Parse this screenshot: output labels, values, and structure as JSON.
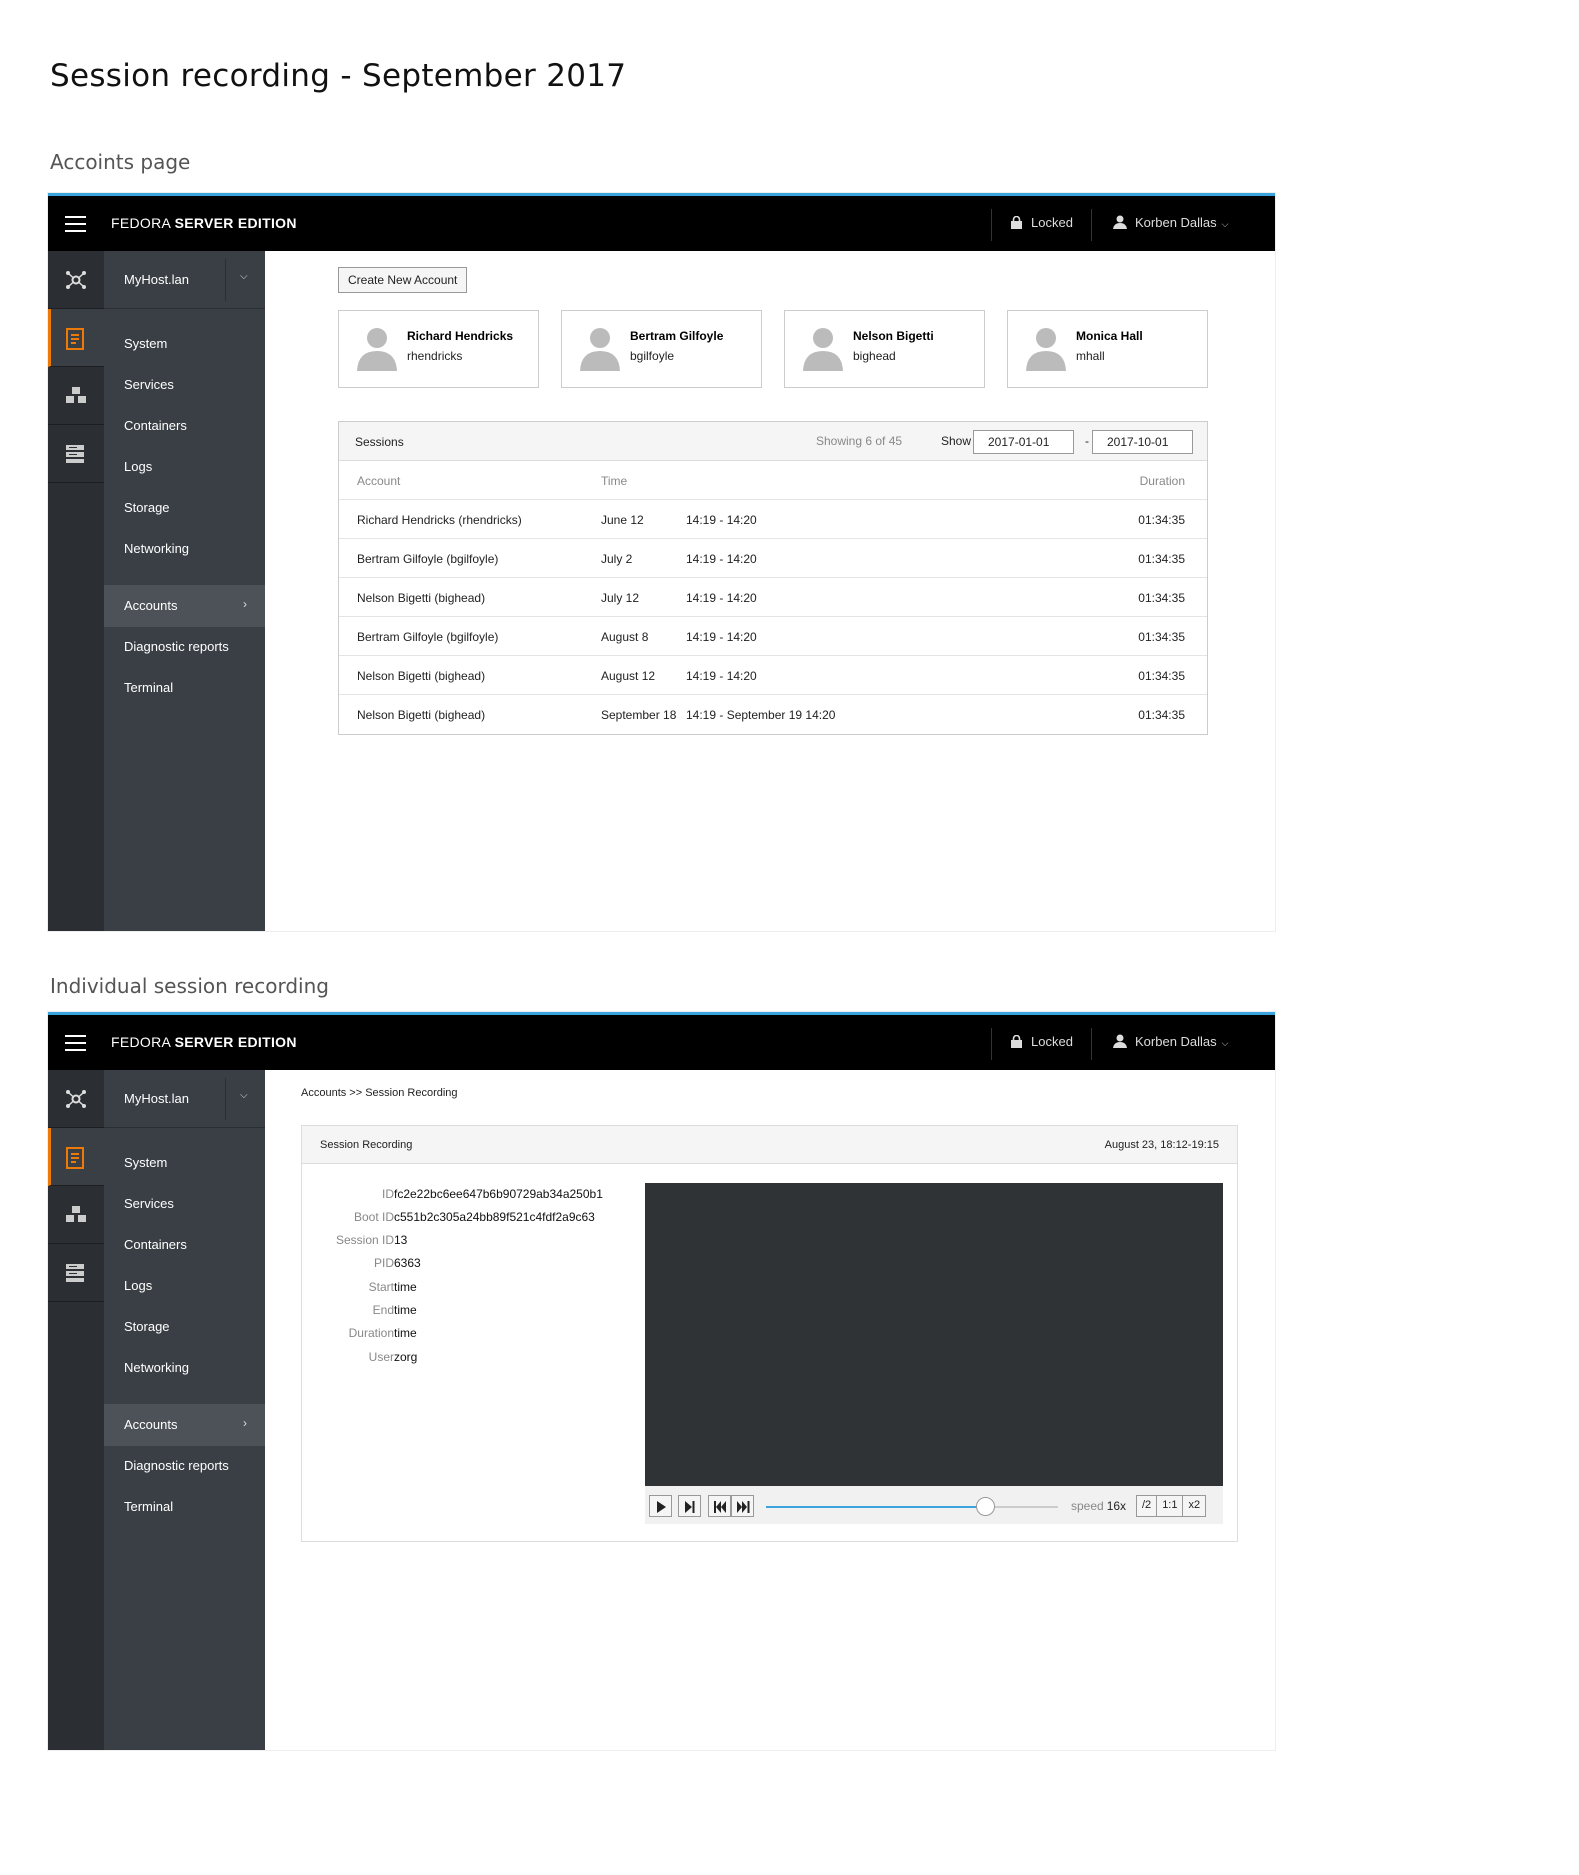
{
  "page_title": "Session recording - September 2017",
  "section1_title": "Accoints page",
  "section2_title": "Individual session recording",
  "topbar": {
    "brand_light": "FEDORA ",
    "brand_bold": "SERVER EDITION",
    "locked": "Locked",
    "user": "Korben Dallas"
  },
  "nav": {
    "host": "MyHost.lan",
    "items": [
      "System",
      "Services",
      "Containers",
      "Logs",
      "Storage",
      "Networking",
      "Accounts",
      "Diagnostic reports",
      "Terminal"
    ],
    "active": "Accounts"
  },
  "accounts": {
    "create_button": "Create New Account",
    "cards": [
      {
        "name": "Richard Hendricks",
        "user": "rhendricks"
      },
      {
        "name": "Bertram Gilfoyle",
        "user": "bgilfoyle"
      },
      {
        "name": "Nelson Bigetti",
        "user": "bighead"
      },
      {
        "name": "Monica Hall",
        "user": "mhall"
      }
    ]
  },
  "sessions": {
    "title": "Sessions",
    "showing": "Showing 6 of 45",
    "show_label": "Show",
    "date_from": "2017-01-01",
    "date_sep": "-",
    "date_to": "2017-10-01",
    "headers": {
      "account": "Account",
      "time": "Time",
      "duration": "Duration"
    },
    "rows": [
      {
        "account": "Richard Hendricks (rhendricks)",
        "date": "June 12",
        "range": "14:19 - 14:20",
        "duration": "01:34:35"
      },
      {
        "account": "Bertram Gilfoyle (bgilfoyle)",
        "date": "July 2",
        "range": "14:19 - 14:20",
        "duration": "01:34:35"
      },
      {
        "account": "Nelson Bigetti (bighead)",
        "date": "July 12",
        "range": "14:19 - 14:20",
        "duration": "01:34:35"
      },
      {
        "account": "Bertram Gilfoyle (bgilfoyle)",
        "date": "August 8",
        "range": "14:19 - 14:20",
        "duration": "01:34:35"
      },
      {
        "account": "Nelson Bigetti (bighead)",
        "date": "August 12",
        "range": "14:19 - 14:20",
        "duration": "01:34:35"
      },
      {
        "account": "Nelson Bigetti (bighead)",
        "date": "September 18",
        "range": "14:19 -  September 19 14:20",
        "duration": "01:34:35"
      }
    ]
  },
  "recording": {
    "breadcrumb": "Accounts >> Session Recording",
    "title": "Session Recording",
    "when": "August 23, 18:12-19:15",
    "fields": [
      {
        "k": "ID",
        "v": "fc2e22bc6ee647b6b90729ab34a250b1"
      },
      {
        "k": "Boot ID",
        "v": "c551b2c305a24bb89f521c4fdf2a9c63"
      },
      {
        "k": "Session ID",
        "v": "13"
      },
      {
        "k": "PID",
        "v": "6363"
      },
      {
        "k": "Start",
        "v": "time"
      },
      {
        "k": "End",
        "v": "time"
      },
      {
        "k": "Duration",
        "v": "time"
      },
      {
        "k": "User",
        "v": "zorg"
      }
    ],
    "progress": 0.75,
    "speed_label": "speed",
    "speed_value": "16x",
    "speed_buttons": [
      "/2",
      "1:1",
      "x2"
    ]
  },
  "colors": {
    "accent_blue": "#39a5dc",
    "active_orange": "#ec7a08",
    "terminal_bg": "#303336"
  }
}
